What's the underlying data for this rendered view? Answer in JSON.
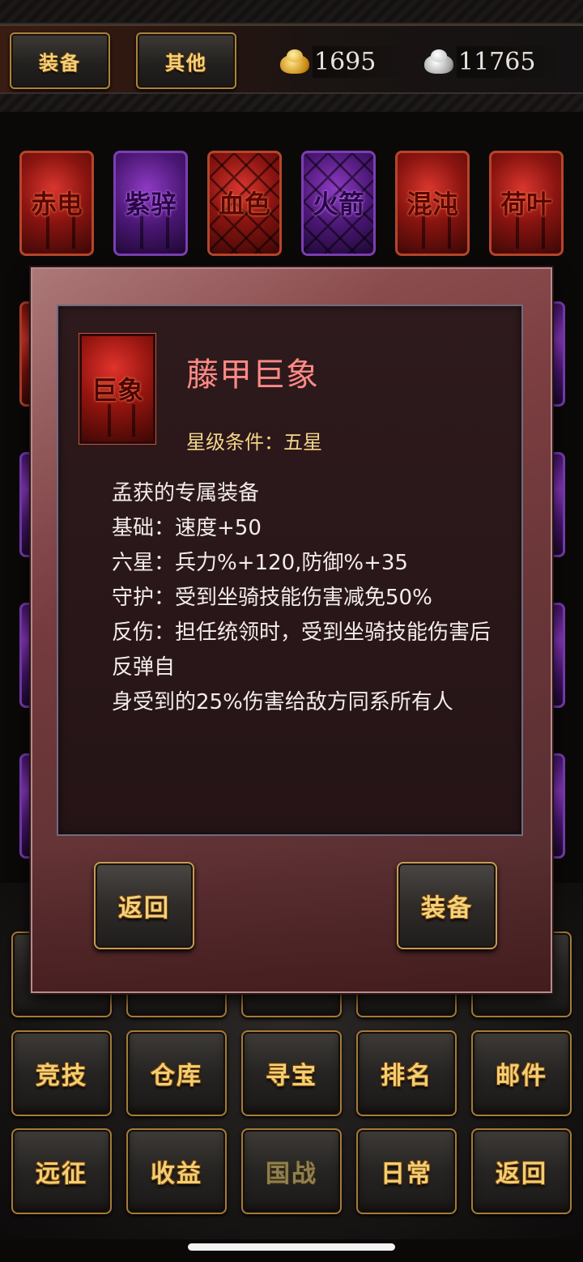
{
  "header": {
    "tab_equipment": "装备",
    "tab_other": "其他",
    "gold": "1695",
    "silver": "11765",
    "gold_icon": "gold-ingot-icon",
    "silver_icon": "silver-ingot-icon"
  },
  "mounts": [
    {
      "name": "赤电",
      "style": "red"
    },
    {
      "name": "紫骍",
      "style": "purple"
    },
    {
      "name": "血色",
      "style": "red-diamond"
    },
    {
      "name": "火箭",
      "style": "purple-diamond"
    },
    {
      "name": "混沌",
      "style": "red"
    },
    {
      "name": "荷叶",
      "style": "red"
    }
  ],
  "modal": {
    "item_icon_label": "巨象",
    "item_name": "藤甲巨象",
    "star_condition": "星级条件：五星",
    "description": [
      "孟获的专属装备",
      "基础：速度+50",
      "六星：兵力%+120,防御%+35",
      "守护：受到坐骑技能伤害减免50%",
      "反伤：担任统领时，受到坐骑技能伤害后反弹自",
      "身受到的25%伤害给敌方同系所有人"
    ],
    "back_button": "返回",
    "equip_button": "装备"
  },
  "menu": {
    "row1": [
      "竞技",
      "仓库",
      "寻宝",
      "排名",
      "邮件"
    ],
    "row2": [
      "远征",
      "收益",
      "国战",
      "日常",
      "返回"
    ]
  },
  "colors": {
    "gold_text": "#f1cf72",
    "item_name": "#ff8a86",
    "star_condition": "#f3d58a",
    "button_border": "#a67b3a"
  }
}
